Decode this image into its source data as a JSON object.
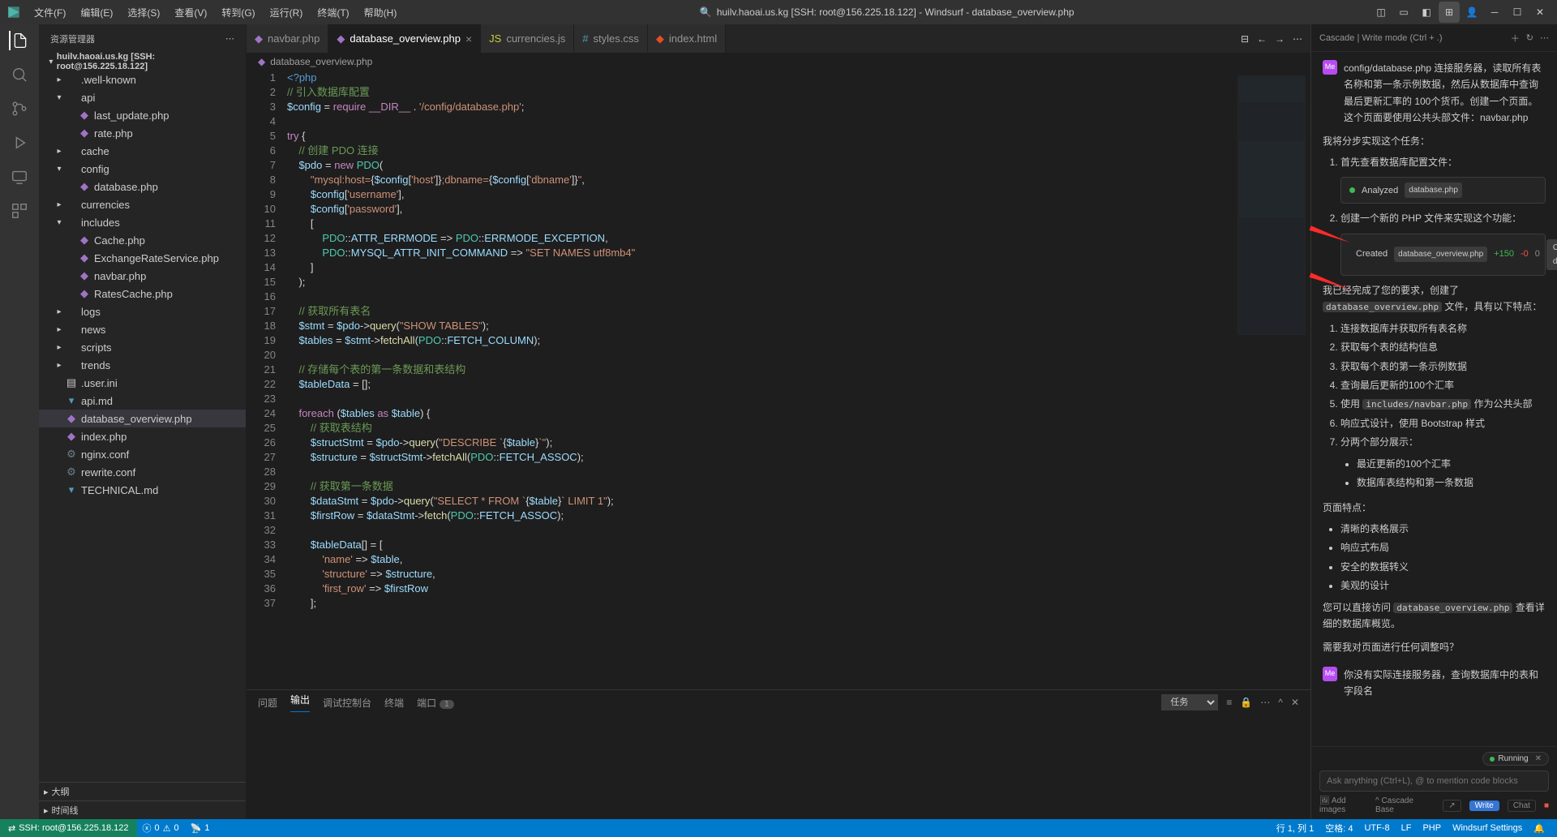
{
  "title": "huilv.haoai.us.kg [SSH: root@156.225.18.122] - Windsurf - database_overview.php",
  "menubar": [
    "文件(F)",
    "编辑(E)",
    "选择(S)",
    "查看(V)",
    "转到(G)",
    "运行(R)",
    "终端(T)",
    "帮助(H)"
  ],
  "sidebar_title": "资源管理器",
  "workspace_name": "huilv.haoai.us.kg [SSH: root@156.225.18.122]",
  "tree": [
    {
      "d": 1,
      "t": "folder",
      "open": false,
      "name": ".well-known"
    },
    {
      "d": 1,
      "t": "folder",
      "open": true,
      "name": "api"
    },
    {
      "d": 2,
      "t": "php",
      "name": "last_update.php"
    },
    {
      "d": 2,
      "t": "php",
      "name": "rate.php"
    },
    {
      "d": 1,
      "t": "folder",
      "open": false,
      "name": "cache"
    },
    {
      "d": 1,
      "t": "folder",
      "open": true,
      "name": "config"
    },
    {
      "d": 2,
      "t": "php",
      "name": "database.php"
    },
    {
      "d": 1,
      "t": "folder",
      "open": false,
      "name": "currencies"
    },
    {
      "d": 1,
      "t": "folder",
      "open": true,
      "name": "includes"
    },
    {
      "d": 2,
      "t": "php",
      "name": "Cache.php"
    },
    {
      "d": 2,
      "t": "php",
      "name": "ExchangeRateService.php"
    },
    {
      "d": 2,
      "t": "php",
      "name": "navbar.php"
    },
    {
      "d": 2,
      "t": "php",
      "name": "RatesCache.php"
    },
    {
      "d": 1,
      "t": "folder",
      "open": false,
      "name": "logs"
    },
    {
      "d": 1,
      "t": "folder",
      "open": false,
      "name": "news"
    },
    {
      "d": 1,
      "t": "folder",
      "open": false,
      "name": "scripts"
    },
    {
      "d": 1,
      "t": "folder",
      "open": false,
      "name": "trends"
    },
    {
      "d": 1,
      "t": "file",
      "name": ".user.ini"
    },
    {
      "d": 1,
      "t": "md",
      "name": "api.md"
    },
    {
      "d": 1,
      "t": "php",
      "name": "database_overview.php",
      "selected": true
    },
    {
      "d": 1,
      "t": "php",
      "name": "index.php"
    },
    {
      "d": 1,
      "t": "conf",
      "name": "nginx.conf"
    },
    {
      "d": 1,
      "t": "conf",
      "name": "rewrite.conf"
    },
    {
      "d": 1,
      "t": "md",
      "name": "TECHNICAL.md"
    }
  ],
  "outline": [
    "大纲",
    "时间线"
  ],
  "tabs": [
    {
      "icon": "php",
      "label": "navbar.php"
    },
    {
      "icon": "php",
      "label": "database_overview.php",
      "active": true,
      "close": true
    },
    {
      "icon": "js",
      "label": "currencies.js"
    },
    {
      "icon": "css",
      "label": "styles.css"
    },
    {
      "icon": "html",
      "label": "index.html"
    }
  ],
  "breadcrumb": "database_overview.php",
  "code_lines": [
    "<span class='php-open'>&lt;?php</span>",
    "<span class='c'>// 引入数据库配置</span>",
    "<span class='v'>$config</span> <span class='o'>=</span> <span class='k'>require</span> <span class='k'>__DIR__</span> <span class='o'>.</span> <span class='s'>'/config/database.php'</span>;",
    "",
    "<span class='k'>try</span> {",
    "    <span class='c'>// 创建 PDO 连接</span>",
    "    <span class='v'>$pdo</span> <span class='o'>=</span> <span class='k'>new</span> <span class='t'>PDO</span>(",
    "        <span class='s'>\"mysql:host=</span>{<span class='v'>$config</span>[<span class='s'>'host'</span>]}<span class='s'>;dbname=</span>{<span class='v'>$config</span>[<span class='s'>'dbname'</span>]}<span class='s'>\"</span>,",
    "        <span class='v'>$config</span>[<span class='s'>'username'</span>],",
    "        <span class='v'>$config</span>[<span class='s'>'password'</span>],",
    "        [",
    "            <span class='t'>PDO</span>::<span class='v'>ATTR_ERRMODE</span> <span class='o'>=&gt;</span> <span class='t'>PDO</span>::<span class='v'>ERRMODE_EXCEPTION</span>,",
    "            <span class='t'>PDO</span>::<span class='v'>MYSQL_ATTR_INIT_COMMAND</span> <span class='o'>=&gt;</span> <span class='s'>\"SET NAMES utf8mb4\"</span>",
    "        ]",
    "    );",
    "",
    "    <span class='c'>// 获取所有表名</span>",
    "    <span class='v'>$stmt</span> <span class='o'>=</span> <span class='v'>$pdo</span>-&gt;<span class='f'>query</span>(<span class='s'>\"SHOW TABLES\"</span>);",
    "    <span class='v'>$tables</span> <span class='o'>=</span> <span class='v'>$stmt</span>-&gt;<span class='f'>fetchAll</span>(<span class='t'>PDO</span>::<span class='v'>FETCH_COLUMN</span>);",
    "",
    "    <span class='c'>// 存储每个表的第一条数据和表结构</span>",
    "    <span class='v'>$tableData</span> <span class='o'>=</span> [];",
    "",
    "    <span class='k'>foreach</span> (<span class='v'>$tables</span> <span class='k'>as</span> <span class='v'>$table</span>) {",
    "        <span class='c'>// 获取表结构</span>",
    "        <span class='v'>$structStmt</span> <span class='o'>=</span> <span class='v'>$pdo</span>-&gt;<span class='f'>query</span>(<span class='s'>\"DESCRIBE `</span>{<span class='v'>$table</span>}<span class='s'>`\"</span>);",
    "        <span class='v'>$structure</span> <span class='o'>=</span> <span class='v'>$structStmt</span>-&gt;<span class='f'>fetchAll</span>(<span class='t'>PDO</span>::<span class='v'>FETCH_ASSOC</span>);",
    "",
    "        <span class='c'>// 获取第一条数据</span>",
    "        <span class='v'>$dataStmt</span> <span class='o'>=</span> <span class='v'>$pdo</span>-&gt;<span class='f'>query</span>(<span class='s'>\"SELECT * FROM `</span>{<span class='v'>$table</span>}<span class='s'>` LIMIT 1\"</span>);",
    "        <span class='v'>$firstRow</span> <span class='o'>=</span> <span class='v'>$dataStmt</span>-&gt;<span class='f'>fetch</span>(<span class='t'>PDO</span>::<span class='v'>FETCH_ASSOC</span>);",
    "",
    "        <span class='v'>$tableData</span>[] <span class='o'>=</span> [",
    "            <span class='s'>'name'</span> <span class='o'>=&gt;</span> <span class='v'>$table</span>,",
    "            <span class='s'>'structure'</span> <span class='o'>=&gt;</span> <span class='v'>$structure</span>,",
    "            <span class='s'>'first_row'</span> <span class='o'>=&gt;</span> <span class='v'>$firstRow</span>",
    "        ];"
  ],
  "panel": {
    "tabs": [
      "问题",
      "输出",
      "调试控制台",
      "终端",
      "端口"
    ],
    "active": "输出",
    "port_badge": "1",
    "task_select": "任务"
  },
  "cascade": {
    "header": "Cascade | Write mode (Ctrl + .)",
    "user_msg": "config/database.php 连接服务器，读取所有表名称和第一条示例数据，然后从数据库中查询最后更新汇率的 100个货币。创建一个页面。这个页面要使用公共头部文件：navbar.php",
    "assist_intro": "我将分步实现这个任务：",
    "step1": "首先查看数据库配置文件：",
    "tool1": {
      "label": "Analyzed",
      "file": "database.php"
    },
    "step2": "创建一个新的 PHP 文件来实现这个功能：",
    "tool2": {
      "label": "Created",
      "file": "database_overview.php",
      "add": "+150",
      "del": "-0",
      "zero": "0",
      "btn": "Open diff"
    },
    "done": "我已经完成了您的要求，创建了",
    "done_file": "database_overview.php",
    "done_tail": "文件，具有以下特点：",
    "feat": [
      "连接数据库并获取所有表名称",
      "获取每个表的结构信息",
      "获取每个表的第一条示例数据",
      "查询最后更新的100个汇率",
      "使用 includes/navbar.php 作为公共头部",
      "响应式设计，使用 Bootstrap 样式",
      "分两个部分展示："
    ],
    "sub": [
      "最近更新的100个汇率",
      "数据库表结构和第一条数据"
    ],
    "page_feat_h": "页面特点：",
    "page_feat": [
      "清晰的表格展示",
      "响应式布局",
      "安全的数据转义",
      "美观的设计"
    ],
    "visit_pre": "您可以直接访问",
    "visit_file": "database_overview.php",
    "visit_post": "查看详细的数据库概览。",
    "ask": "需要我对页面进行任何调整吗？",
    "user2": "你没有实际连接服务器，查询数据库中的表和字段名",
    "running": "Running",
    "placeholder": "Ask anything (Ctrl+L), @ to mention code blocks",
    "add_images": "Add images",
    "base": "Cascade Base",
    "write": "Write",
    "chat": "Chat"
  },
  "status": {
    "remote": "SSH: root@156.225.18.122",
    "errors": "0",
    "warnings": "0",
    "ports": "1",
    "cursor": "行 1, 列 1",
    "spaces": "空格: 4",
    "enc": "UTF-8",
    "eol": "LF",
    "lang": "PHP",
    "settings": "Windsurf Settings"
  }
}
